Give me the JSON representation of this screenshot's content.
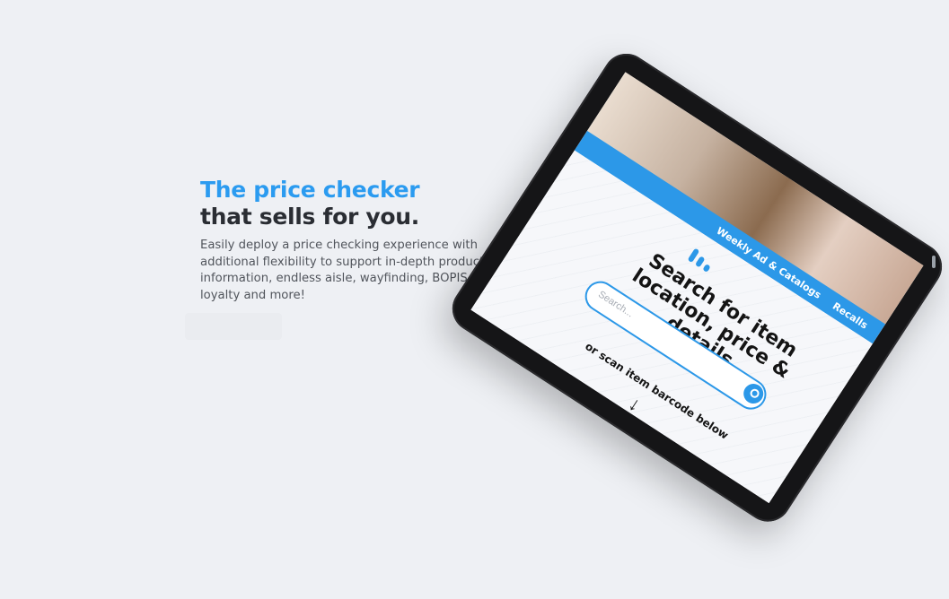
{
  "hero": {
    "headline_accent": "The price checker",
    "headline_dark": "that sells for you.",
    "description": "Easily deploy a price checking experience with additional flexibility to support in-depth product information, endless aisle, wayfinding, BOPIS, loyalty and more!"
  },
  "device_screen": {
    "nav_items": [
      "Weekly Ad & Catalogs",
      "Recalls"
    ],
    "heading": "Search for item location, price & details",
    "search_placeholder": "Search...",
    "scan_prompt": "or scan item barcode below",
    "arrow_glyph": "↓"
  },
  "colors": {
    "accent": "#2b9bf0",
    "headline_dark": "#2a2d33",
    "background": "#eef0f4",
    "scanner_red": "#d3142a"
  }
}
